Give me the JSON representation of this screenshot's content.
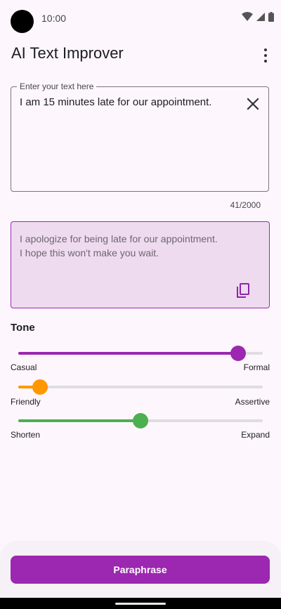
{
  "status_bar": {
    "time": "10:00"
  },
  "app_bar": {
    "title": "AI Text Improver",
    "menu_icon": "more-vert-icon"
  },
  "input": {
    "label": "Enter your text here",
    "value": "I am 15 minutes late for our appointment.",
    "counter": "41/2000",
    "clear_icon": "close-icon"
  },
  "output": {
    "text_line1": "I apologize for being late for our appointment.",
    "text_line2": "I hope this won't make you wait.",
    "copy_icon": "copy-icon"
  },
  "tone": {
    "heading": "Tone",
    "sliders": [
      {
        "left_label": "Casual",
        "right_label": "Formal",
        "value": 0.9,
        "color": "#9c27b0"
      },
      {
        "left_label": "Friendly",
        "right_label": "Assertive",
        "value": 0.09,
        "color": "#ff9800"
      },
      {
        "left_label": "Shorten",
        "right_label": "Expand",
        "value": 0.5,
        "color": "#4caf50"
      }
    ]
  },
  "action": {
    "label": "Paraphrase",
    "color": "#9c27b0"
  }
}
